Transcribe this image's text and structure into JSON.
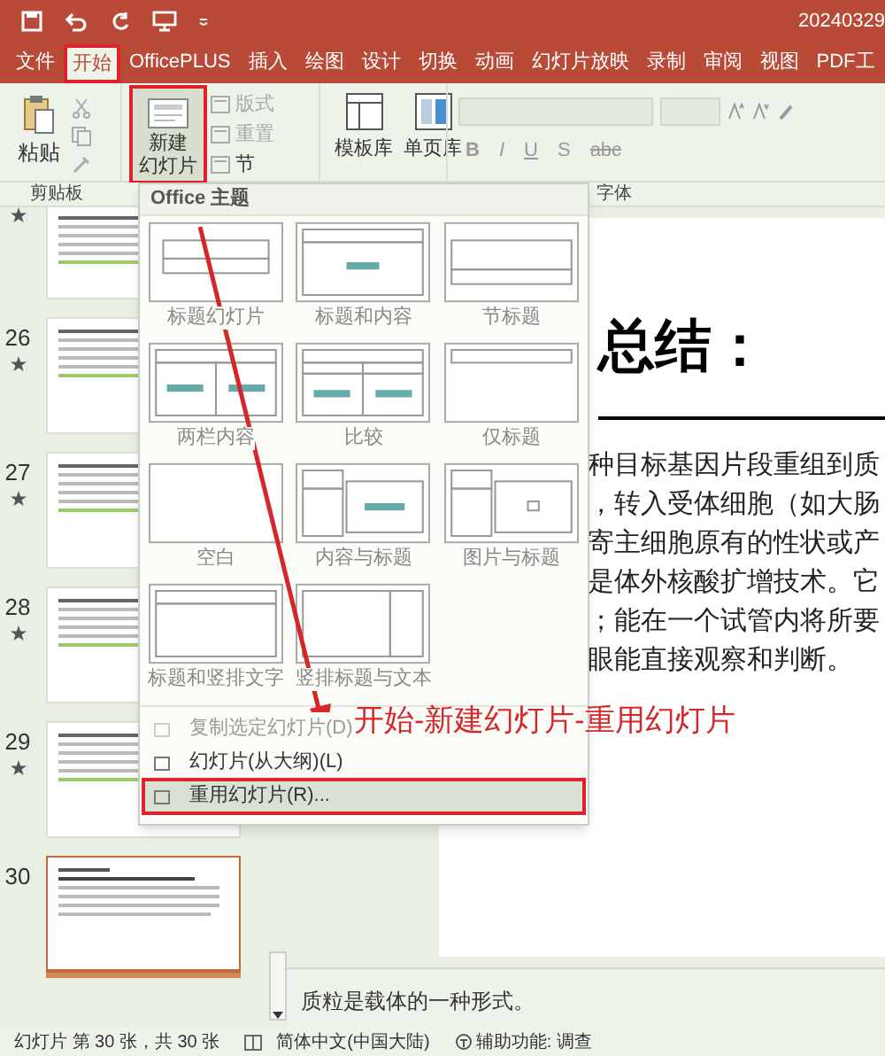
{
  "title_bar": {
    "title": "20240329"
  },
  "tabs": [
    {
      "label": "文件",
      "selected": false,
      "highlighted": false
    },
    {
      "label": "开始",
      "selected": true,
      "highlighted": true
    },
    {
      "label": "OfficePLUS",
      "selected": false,
      "highlighted": false
    },
    {
      "label": "插入",
      "selected": false,
      "highlighted": false
    },
    {
      "label": "绘图",
      "selected": false,
      "highlighted": false
    },
    {
      "label": "设计",
      "selected": false,
      "highlighted": false
    },
    {
      "label": "切换",
      "selected": false,
      "highlighted": false
    },
    {
      "label": "动画",
      "selected": false,
      "highlighted": false
    },
    {
      "label": "幻灯片放映",
      "selected": false,
      "highlighted": false
    },
    {
      "label": "录制",
      "selected": false,
      "highlighted": false
    },
    {
      "label": "审阅",
      "selected": false,
      "highlighted": false
    },
    {
      "label": "视图",
      "selected": false,
      "highlighted": false
    },
    {
      "label": "PDF工",
      "selected": false,
      "highlighted": false
    }
  ],
  "ribbon": {
    "paste": "粘贴",
    "new_slide": {
      "lines": [
        "新建",
        "幻灯片"
      ],
      "highlighted": true
    },
    "small_buttons": [
      "版式",
      "重置",
      "节"
    ],
    "gallery_buttons": [
      "模板库",
      "单页库"
    ],
    "font_buttons": [
      "B",
      "I",
      "U",
      "S",
      "abc"
    ],
    "group_labels": [
      "剪贴板",
      "字体"
    ]
  },
  "slides_pane": {
    "slides": [
      {
        "starred": true,
        "selected": false
      },
      {
        "number": "26",
        "starred": true,
        "selected": false
      },
      {
        "number": "27",
        "starred": true,
        "selected": false
      },
      {
        "number": "28",
        "starred": true,
        "selected": false
      },
      {
        "number": "29",
        "starred": true,
        "selected": false
      },
      {
        "number": "30",
        "starred": false,
        "selected": true
      }
    ]
  },
  "slide": {
    "title": "总结：",
    "body": [
      "种目标基因片段重组到质",
      "，转入受体细胞（如大肠",
      "寄主细胞原有的性状或产",
      "是体外核酸扩增技术。它",
      "；能在一个试管内将所要",
      "眼能直接观察和判断。"
    ]
  },
  "notes": "质粒是载体的一种形式。",
  "menu": {
    "header": "Office 主题",
    "layouts": [
      {
        "label": "标题幻灯片",
        "kind": "title"
      },
      {
        "label": "标题和内容",
        "kind": "title_content"
      },
      {
        "label": "节标题",
        "kind": "section"
      },
      {
        "label": "两栏内容",
        "kind": "two_content"
      },
      {
        "label": "比较",
        "kind": "comparison"
      },
      {
        "label": "仅标题",
        "kind": "title_only"
      },
      {
        "label": "空白",
        "kind": "blank"
      },
      {
        "label": "内容与标题",
        "kind": "content_caption"
      },
      {
        "label": "图片与标题",
        "kind": "picture_caption"
      },
      {
        "label": "标题和竖排文字",
        "kind": "title_vertical"
      },
      {
        "label": "竖排标题与文本",
        "kind": "vertical_title"
      }
    ],
    "items": [
      {
        "label": "复制选定幻灯片(D)",
        "disabled": true,
        "selected": false
      },
      {
        "label": "幻灯片(从大纲)(L)",
        "disabled": false,
        "selected": false
      },
      {
        "label": "重用幻灯片(R)...",
        "disabled": false,
        "selected": true
      }
    ]
  },
  "annotation": {
    "text": "开始-新建幻灯片-重用幻灯片"
  },
  "status_bar": {
    "slide_count": "幻灯片 第 30 张，共 30 张",
    "language": "简体中文(中国大陆)",
    "accessibility": "辅助功能: 调查"
  }
}
